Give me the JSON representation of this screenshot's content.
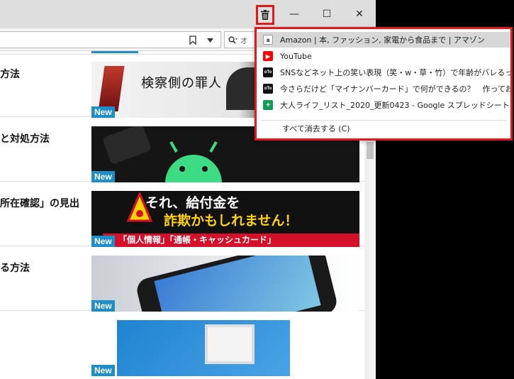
{
  "titlebar": {
    "trash_icon": "trash-icon",
    "minimize_glyph": "—",
    "maximize_glyph": "☐",
    "close_glyph": "✕"
  },
  "toolbar": {
    "bookmark_glyph": "⌑",
    "dropdown_glyph": "▼",
    "search_text": "オ"
  },
  "articles": [
    {
      "title": "方法",
      "badge": "New",
      "thumb_caption": "検察側の罪人"
    },
    {
      "title": "と対処方法",
      "badge": "New"
    },
    {
      "title": "所在確認」の見出",
      "badge": "New",
      "thumb_caption_1": "それ、給付金を",
      "thumb_caption_2": "詐欺かもしれません！",
      "thumb_caption_3": "「個人情報」「通帳・キャッシュカード」"
    },
    {
      "title": "る方法",
      "badge": "New"
    },
    {
      "title": "",
      "badge": "New"
    }
  ],
  "dropdown": {
    "items": [
      {
        "label": "Amazon | 本, ファッション, 家電から食品まで | アマゾン",
        "favicon": "amazon-icon",
        "color": "#ffffff"
      },
      {
        "label": "YouTube",
        "favicon": "youtube-icon",
        "color": "#ff0000"
      },
      {
        "label": "SNSなどネット上の笑い表現（笑・w・草・竹）で年齢がバレるって知っ",
        "favicon": "oto-icon",
        "color": "#111111"
      },
      {
        "label": "今さらだけど「マイナンバーカード」で何ができるの？　作っておいたほうが",
        "favicon": "oto-icon",
        "color": "#111111"
      },
      {
        "label": "大人ライフ_リスト_2020_更新0423 - Google スプレッドシート",
        "favicon": "sheets-icon",
        "color": "#0f9d58"
      }
    ],
    "clear_all": "すべて消去する (C)"
  },
  "colors": {
    "highlight": "#e0191f",
    "badge": "#1e8ec9"
  }
}
